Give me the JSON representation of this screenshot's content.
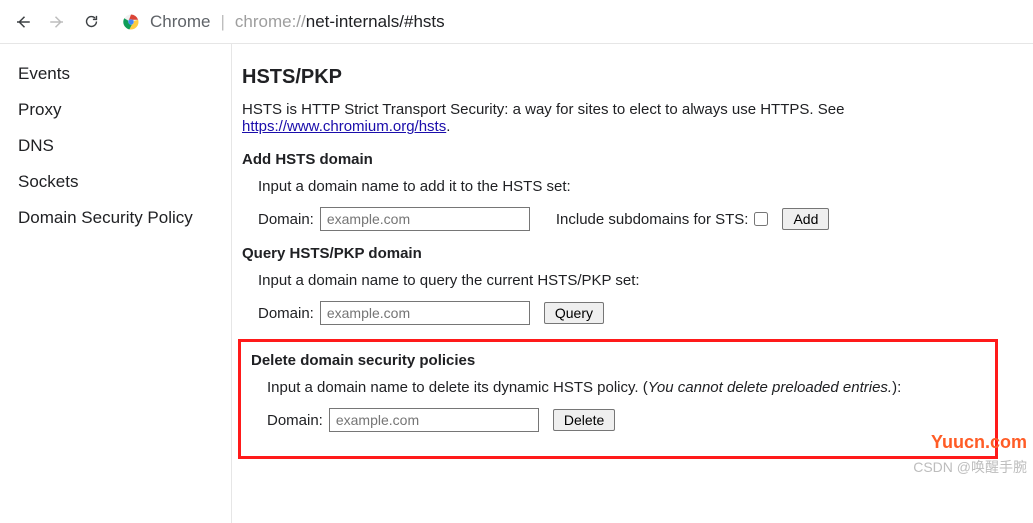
{
  "toolbar": {
    "label": "Chrome",
    "url_prefix": "chrome://",
    "url_rest": "net-internals/#hsts"
  },
  "sidebar": {
    "items": [
      {
        "label": "Events"
      },
      {
        "label": "Proxy"
      },
      {
        "label": "DNS"
      },
      {
        "label": "Sockets"
      },
      {
        "label": "Domain Security Policy"
      }
    ]
  },
  "main": {
    "title": "HSTS/PKP",
    "intro_text": "HSTS is HTTP Strict Transport Security: a way for sites to elect to always use HTTPS. See ",
    "intro_link": "https://www.chromium.org/hsts",
    "intro_period": ".",
    "add": {
      "heading": "Add HSTS domain",
      "hint": "Input a domain name to add it to the HSTS set:",
      "domain_label": "Domain:",
      "placeholder": "example.com",
      "include_label": "Include subdomains for STS:",
      "button": "Add"
    },
    "query": {
      "heading": "Query HSTS/PKP domain",
      "hint": "Input a domain name to query the current HSTS/PKP set:",
      "domain_label": "Domain:",
      "placeholder": "example.com",
      "button": "Query"
    },
    "del": {
      "heading": "Delete domain security policies",
      "hint_pre": "Input a domain name to delete its dynamic HSTS policy. (",
      "hint_ital": "You cannot delete preloaded entries.",
      "hint_post": "):",
      "domain_label": "Domain:",
      "placeholder": "example.com",
      "button": "Delete"
    }
  },
  "watermark": {
    "site": "Yuucn.com",
    "attr": "CSDN @唤醒手腕"
  }
}
